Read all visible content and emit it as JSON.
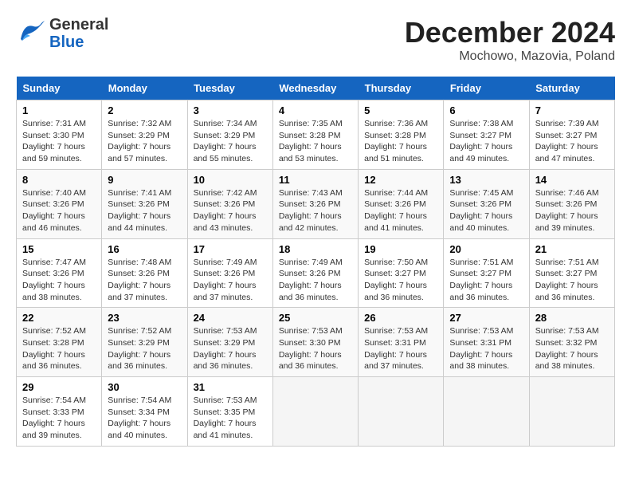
{
  "header": {
    "logo_general": "General",
    "logo_blue": "Blue",
    "title": "December 2024",
    "subtitle": "Mochowo, Mazovia, Poland"
  },
  "columns": [
    "Sunday",
    "Monday",
    "Tuesday",
    "Wednesday",
    "Thursday",
    "Friday",
    "Saturday"
  ],
  "weeks": [
    [
      {
        "day": "1",
        "sunrise": "Sunrise: 7:31 AM",
        "sunset": "Sunset: 3:30 PM",
        "daylight": "Daylight: 7 hours and 59 minutes."
      },
      {
        "day": "2",
        "sunrise": "Sunrise: 7:32 AM",
        "sunset": "Sunset: 3:29 PM",
        "daylight": "Daylight: 7 hours and 57 minutes."
      },
      {
        "day": "3",
        "sunrise": "Sunrise: 7:34 AM",
        "sunset": "Sunset: 3:29 PM",
        "daylight": "Daylight: 7 hours and 55 minutes."
      },
      {
        "day": "4",
        "sunrise": "Sunrise: 7:35 AM",
        "sunset": "Sunset: 3:28 PM",
        "daylight": "Daylight: 7 hours and 53 minutes."
      },
      {
        "day": "5",
        "sunrise": "Sunrise: 7:36 AM",
        "sunset": "Sunset: 3:28 PM",
        "daylight": "Daylight: 7 hours and 51 minutes."
      },
      {
        "day": "6",
        "sunrise": "Sunrise: 7:38 AM",
        "sunset": "Sunset: 3:27 PM",
        "daylight": "Daylight: 7 hours and 49 minutes."
      },
      {
        "day": "7",
        "sunrise": "Sunrise: 7:39 AM",
        "sunset": "Sunset: 3:27 PM",
        "daylight": "Daylight: 7 hours and 47 minutes."
      }
    ],
    [
      {
        "day": "8",
        "sunrise": "Sunrise: 7:40 AM",
        "sunset": "Sunset: 3:26 PM",
        "daylight": "Daylight: 7 hours and 46 minutes."
      },
      {
        "day": "9",
        "sunrise": "Sunrise: 7:41 AM",
        "sunset": "Sunset: 3:26 PM",
        "daylight": "Daylight: 7 hours and 44 minutes."
      },
      {
        "day": "10",
        "sunrise": "Sunrise: 7:42 AM",
        "sunset": "Sunset: 3:26 PM",
        "daylight": "Daylight: 7 hours and 43 minutes."
      },
      {
        "day": "11",
        "sunrise": "Sunrise: 7:43 AM",
        "sunset": "Sunset: 3:26 PM",
        "daylight": "Daylight: 7 hours and 42 minutes."
      },
      {
        "day": "12",
        "sunrise": "Sunrise: 7:44 AM",
        "sunset": "Sunset: 3:26 PM",
        "daylight": "Daylight: 7 hours and 41 minutes."
      },
      {
        "day": "13",
        "sunrise": "Sunrise: 7:45 AM",
        "sunset": "Sunset: 3:26 PM",
        "daylight": "Daylight: 7 hours and 40 minutes."
      },
      {
        "day": "14",
        "sunrise": "Sunrise: 7:46 AM",
        "sunset": "Sunset: 3:26 PM",
        "daylight": "Daylight: 7 hours and 39 minutes."
      }
    ],
    [
      {
        "day": "15",
        "sunrise": "Sunrise: 7:47 AM",
        "sunset": "Sunset: 3:26 PM",
        "daylight": "Daylight: 7 hours and 38 minutes."
      },
      {
        "day": "16",
        "sunrise": "Sunrise: 7:48 AM",
        "sunset": "Sunset: 3:26 PM",
        "daylight": "Daylight: 7 hours and 37 minutes."
      },
      {
        "day": "17",
        "sunrise": "Sunrise: 7:49 AM",
        "sunset": "Sunset: 3:26 PM",
        "daylight": "Daylight: 7 hours and 37 minutes."
      },
      {
        "day": "18",
        "sunrise": "Sunrise: 7:49 AM",
        "sunset": "Sunset: 3:26 PM",
        "daylight": "Daylight: 7 hours and 36 minutes."
      },
      {
        "day": "19",
        "sunrise": "Sunrise: 7:50 AM",
        "sunset": "Sunset: 3:27 PM",
        "daylight": "Daylight: 7 hours and 36 minutes."
      },
      {
        "day": "20",
        "sunrise": "Sunrise: 7:51 AM",
        "sunset": "Sunset: 3:27 PM",
        "daylight": "Daylight: 7 hours and 36 minutes."
      },
      {
        "day": "21",
        "sunrise": "Sunrise: 7:51 AM",
        "sunset": "Sunset: 3:27 PM",
        "daylight": "Daylight: 7 hours and 36 minutes."
      }
    ],
    [
      {
        "day": "22",
        "sunrise": "Sunrise: 7:52 AM",
        "sunset": "Sunset: 3:28 PM",
        "daylight": "Daylight: 7 hours and 36 minutes."
      },
      {
        "day": "23",
        "sunrise": "Sunrise: 7:52 AM",
        "sunset": "Sunset: 3:29 PM",
        "daylight": "Daylight: 7 hours and 36 minutes."
      },
      {
        "day": "24",
        "sunrise": "Sunrise: 7:53 AM",
        "sunset": "Sunset: 3:29 PM",
        "daylight": "Daylight: 7 hours and 36 minutes."
      },
      {
        "day": "25",
        "sunrise": "Sunrise: 7:53 AM",
        "sunset": "Sunset: 3:30 PM",
        "daylight": "Daylight: 7 hours and 36 minutes."
      },
      {
        "day": "26",
        "sunrise": "Sunrise: 7:53 AM",
        "sunset": "Sunset: 3:31 PM",
        "daylight": "Daylight: 7 hours and 37 minutes."
      },
      {
        "day": "27",
        "sunrise": "Sunrise: 7:53 AM",
        "sunset": "Sunset: 3:31 PM",
        "daylight": "Daylight: 7 hours and 38 minutes."
      },
      {
        "day": "28",
        "sunrise": "Sunrise: 7:53 AM",
        "sunset": "Sunset: 3:32 PM",
        "daylight": "Daylight: 7 hours and 38 minutes."
      }
    ],
    [
      {
        "day": "29",
        "sunrise": "Sunrise: 7:54 AM",
        "sunset": "Sunset: 3:33 PM",
        "daylight": "Daylight: 7 hours and 39 minutes."
      },
      {
        "day": "30",
        "sunrise": "Sunrise: 7:54 AM",
        "sunset": "Sunset: 3:34 PM",
        "daylight": "Daylight: 7 hours and 40 minutes."
      },
      {
        "day": "31",
        "sunrise": "Sunrise: 7:53 AM",
        "sunset": "Sunset: 3:35 PM",
        "daylight": "Daylight: 7 hours and 41 minutes."
      },
      null,
      null,
      null,
      null
    ]
  ]
}
